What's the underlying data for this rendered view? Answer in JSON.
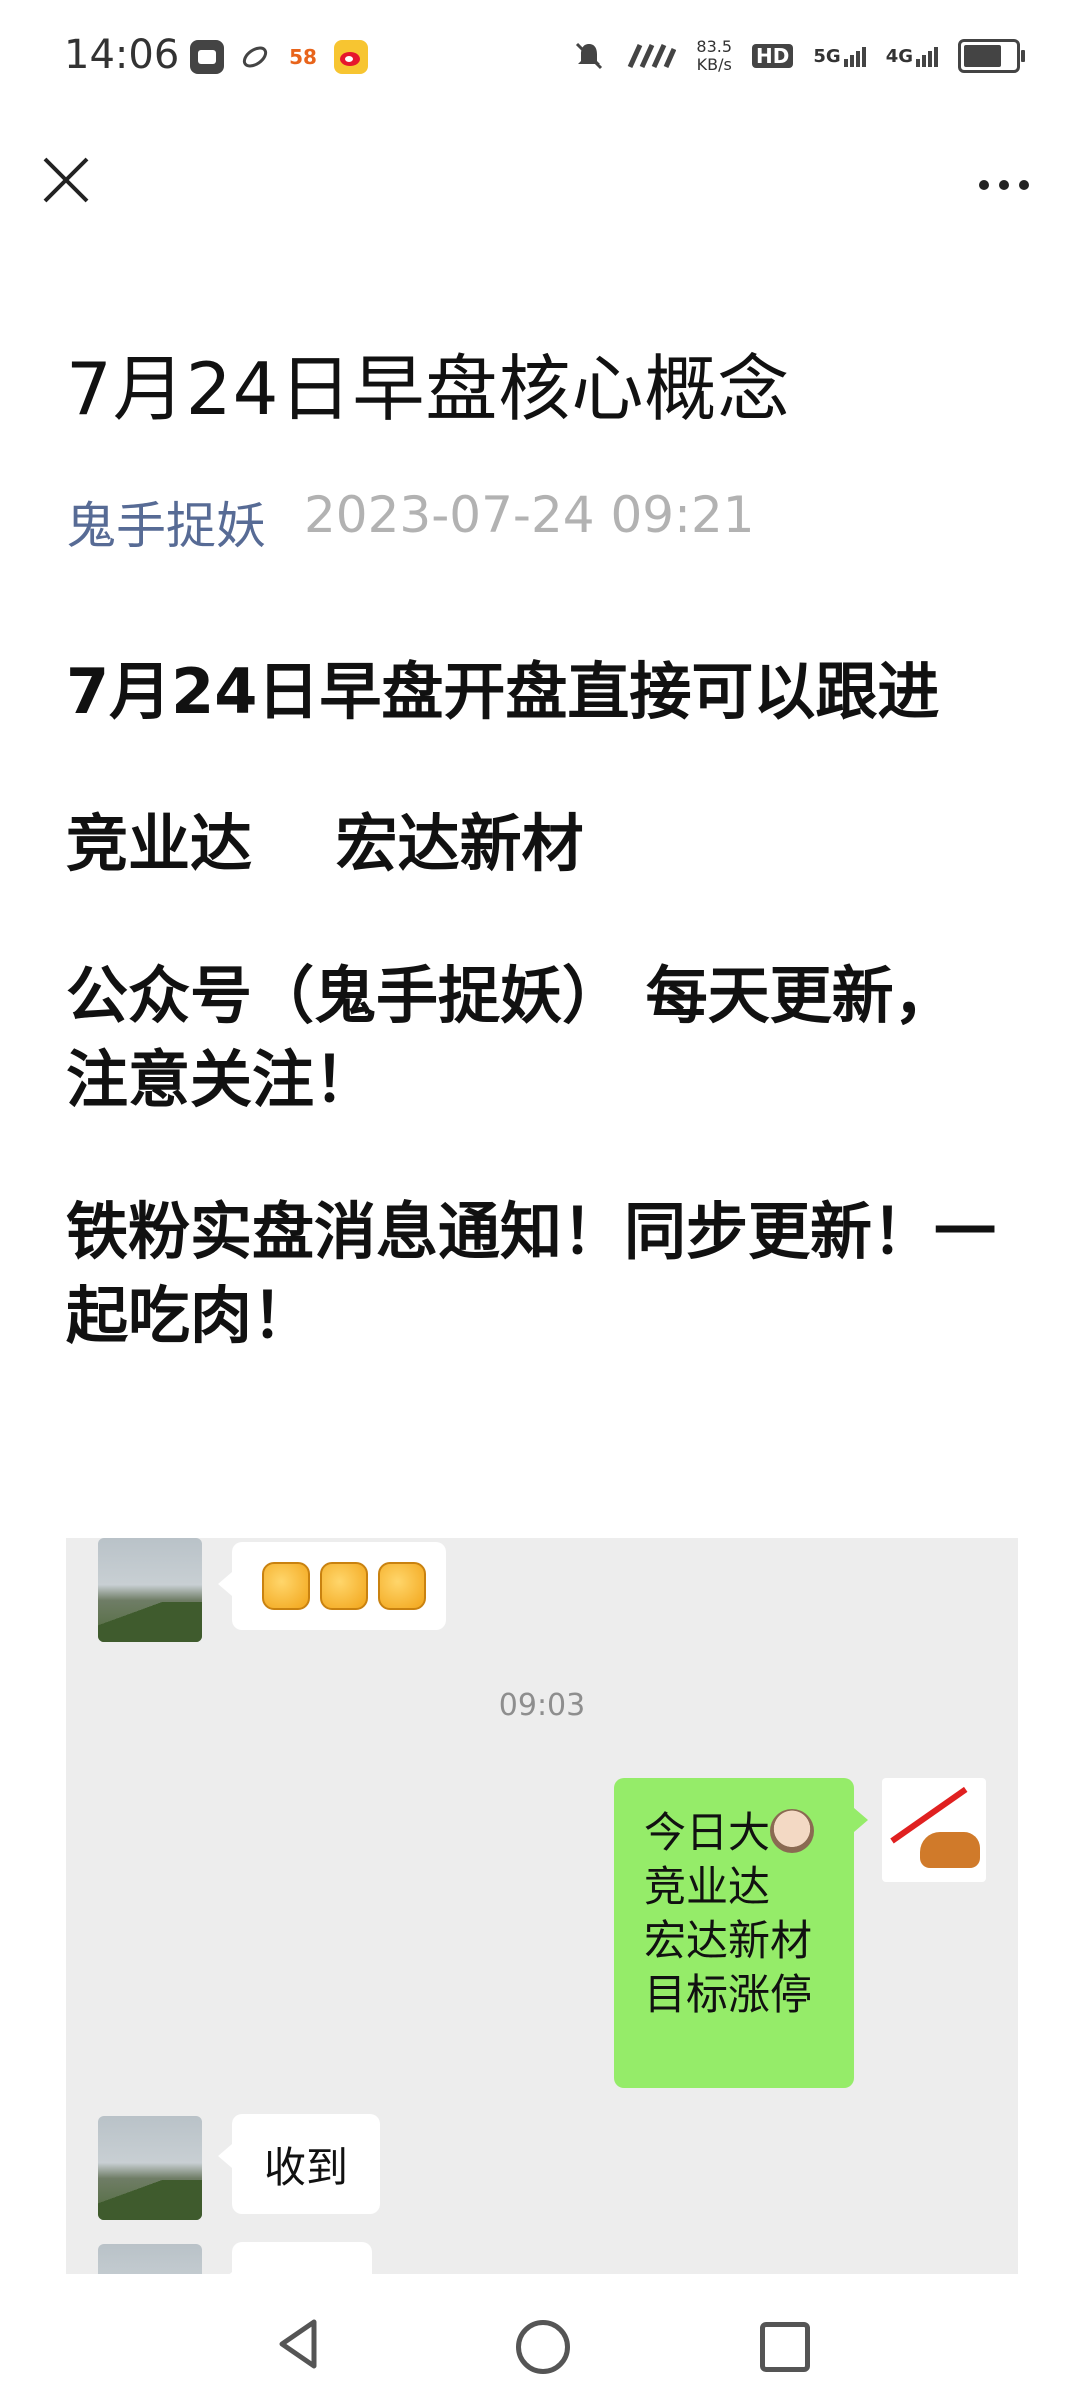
{
  "status_bar": {
    "time": "14:06",
    "app_icons": [
      "message-icon",
      "link-icon",
      "58-icon",
      "weibo-icon"
    ],
    "app_58_label": "58",
    "net_speed_value": "83.5",
    "net_speed_unit": "KB/s",
    "hd_label": "HD",
    "sim1_label": "5G",
    "sim2_label": "4G",
    "battery_level": 0.85
  },
  "nav": {
    "close_icon": "close-icon",
    "more_icon": "more-icon"
  },
  "article": {
    "title": "7月24日早盘核心概念",
    "author": "鬼手捉妖",
    "date": "2023-07-24 09:21",
    "paragraphs": [
      "7月24日早盘开盘直接可以跟进",
      "竞业达　 宏达新材",
      "公众号（鬼手捉妖） 每天更新，注意关注！",
      "铁粉实盘消息通知！同步更新！一起吃肉！"
    ]
  },
  "chat": {
    "timestamp": "09:03",
    "outgoing_lines": [
      "今日大",
      "竞业达",
      "宏达新材",
      "目标涨停"
    ],
    "reply": "收到"
  },
  "colors": {
    "author": "#576b95",
    "date": "#b2b2b2",
    "chat_bg": "#ededed",
    "outgoing_bubble": "#95ec69"
  },
  "bottom_nav": {
    "icons": [
      "back-icon",
      "home-icon",
      "recents-icon"
    ]
  }
}
